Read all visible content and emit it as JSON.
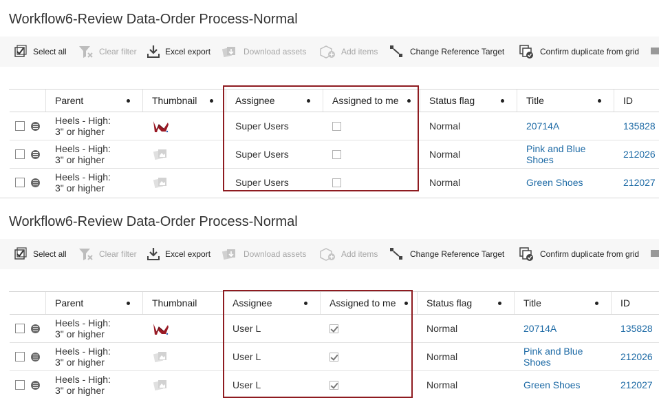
{
  "panels": [
    {
      "title": "Workflow6-Review Data-Order Process-Normal",
      "toolbar": {
        "select_all": "Select all",
        "clear_filter": "Clear filter",
        "excel_export": "Excel export",
        "download_assets": "Download assets",
        "add_items": "Add items",
        "change_reference_target": "Change Reference Target",
        "confirm_duplicate": "Confirm duplicate from grid"
      },
      "columns": [
        "Parent",
        "Thumbnail",
        "Assignee",
        "Assigned to me",
        "Status flag",
        "Title",
        "ID"
      ],
      "rows": [
        {
          "parent_line1": "Heels - High:",
          "parent_line2": "3\" or higher",
          "thumbnail": "red-shoe-thumbnail",
          "assignee": "Super Users",
          "assigned_to_me": false,
          "status": "Normal",
          "title_line1": "20714A",
          "title_line2": "",
          "id": "135828"
        },
        {
          "parent_line1": "Heels - High:",
          "parent_line2": "3\" or higher",
          "thumbnail": "placeholder-thumbnail",
          "assignee": "Super Users",
          "assigned_to_me": false,
          "status": "Normal",
          "title_line1": "Pink and Blue",
          "title_line2": "Shoes",
          "id": "212026"
        },
        {
          "parent_line1": "Heels - High:",
          "parent_line2": "3\" or higher",
          "thumbnail": "placeholder-thumbnail",
          "assignee": "Super Users",
          "assigned_to_me": false,
          "status": "Normal",
          "title_line1": "Green Shoes",
          "title_line2": "",
          "id": "212027"
        }
      ]
    },
    {
      "title": "Workflow6-Review Data-Order Process-Normal",
      "toolbar": {
        "select_all": "Select all",
        "clear_filter": "Clear filter",
        "excel_export": "Excel export",
        "download_assets": "Download assets",
        "add_items": "Add items",
        "change_reference_target": "Change Reference Target",
        "confirm_duplicate": "Confirm duplicate from grid"
      },
      "columns": [
        "Parent",
        "Thumbnail",
        "Assignee",
        "Assigned to me",
        "Status flag",
        "Title",
        "ID"
      ],
      "rows": [
        {
          "parent_line1": "Heels - High:",
          "parent_line2": "3\" or higher",
          "thumbnail": "red-shoe-thumbnail",
          "assignee": "User L",
          "assigned_to_me": true,
          "status": "Normal",
          "title_line1": "20714A",
          "title_line2": "",
          "id": "135828"
        },
        {
          "parent_line1": "Heels - High:",
          "parent_line2": "3\" or higher",
          "thumbnail": "placeholder-thumbnail",
          "assignee": "User L",
          "assigned_to_me": true,
          "status": "Normal",
          "title_line1": "Pink and Blue",
          "title_line2": "Shoes",
          "id": "212026"
        },
        {
          "parent_line1": "Heels - High:",
          "parent_line2": "3\" or higher",
          "thumbnail": "placeholder-thumbnail",
          "assignee": "User L",
          "assigned_to_me": true,
          "status": "Normal",
          "title_line1": "Green Shoes",
          "title_line2": "",
          "id": "212027"
        }
      ]
    }
  ],
  "colors": {
    "highlight_border": "#8e1b20",
    "link": "#1d6aa5",
    "toolbar_bg": "#f7f7f7"
  }
}
